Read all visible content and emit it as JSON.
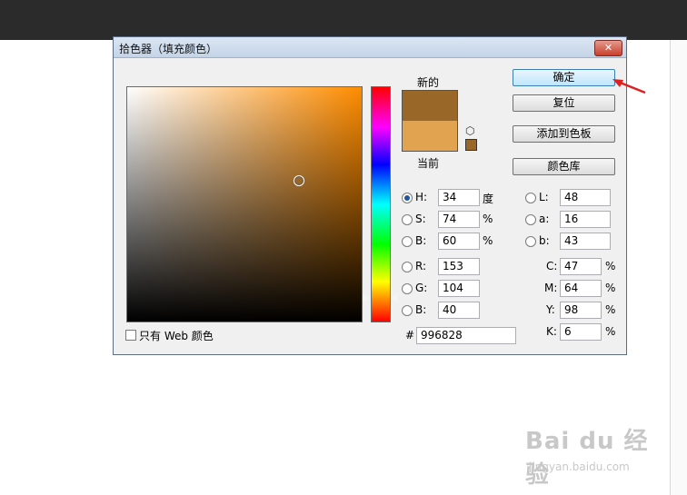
{
  "dialog": {
    "title": "拾色器（填充颜色）",
    "close_label": "✕"
  },
  "swatches": {
    "new_label": "新的",
    "current_label": "当前",
    "new_color": "#996828",
    "current_color": "#e1a350"
  },
  "buttons": {
    "ok": "确定",
    "reset": "复位",
    "add_to_swatches": "添加到色板",
    "color_libraries": "颜色库"
  },
  "hsb": {
    "h_label": "H:",
    "h_value": "34",
    "h_unit": "度",
    "s_label": "S:",
    "s_value": "74",
    "s_unit": "%",
    "b_label": "B:",
    "b_value": "60",
    "b_unit": "%"
  },
  "rgb": {
    "r_label": "R:",
    "r_value": "153",
    "g_label": "G:",
    "g_value": "104",
    "b_label": "B:",
    "b_value": "40"
  },
  "lab": {
    "l_label": "L:",
    "l_value": "48",
    "a_label": "a:",
    "a_value": "16",
    "b_label": "b:",
    "b_value": "43"
  },
  "cmyk": {
    "c_label": "C:",
    "c_value": "47",
    "c_unit": "%",
    "m_label": "M:",
    "m_value": "64",
    "m_unit": "%",
    "y_label": "Y:",
    "y_value": "98",
    "y_unit": "%",
    "k_label": "K:",
    "k_value": "6",
    "k_unit": "%"
  },
  "hex": {
    "label": "#",
    "value": "996828"
  },
  "web_only_label": "只有 Web 颜色",
  "watermark": {
    "brand": "Bai du 经验",
    "url": "jingyan.baidu.com"
  },
  "colors": {
    "accent_arrow": "#e02020"
  }
}
